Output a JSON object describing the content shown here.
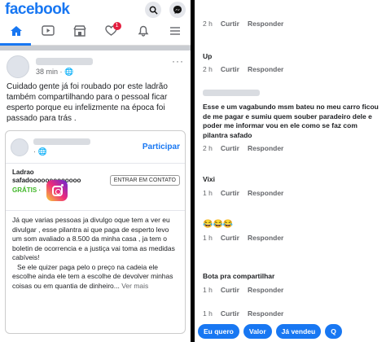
{
  "left": {
    "logo": "facebook",
    "header_icons": [
      "search-icon",
      "messenger-icon"
    ],
    "nav": {
      "tabs": [
        "home-icon",
        "video-icon",
        "marketplace-icon",
        "heart-icon",
        "bell-icon",
        "menu-icon"
      ],
      "active": "home-icon",
      "heart_badge": "1"
    },
    "post": {
      "time": "38 min · 🌐",
      "more": "···",
      "text": "Cuidado gente já foi roubado por este ladrão também compartilhando para o pessoal ficar esperto porque eu infelizmente na época foi passado para trás .",
      "shared": {
        "time": "· 🌐",
        "participar": "Participar",
        "listing_title_1": "Ladrao",
        "listing_title_2": "safadooooooooooooo",
        "contact_button": "ENTRAR EM CONTATO",
        "price": "GRÁTIS ·",
        "body_1": "Já que varias pessoas ja divulgo oque tem a ver eu divulgar , esse pilantra ai que paga de esperto levo um som avaliado a 8.500 da minha casa , ja tem o boletin de ocorrencia e a justiça vai toma as medidas cabíveis!",
        "body_2": "Se ele quizer paga pelo o preço  na cadeia ele escolhe ainda ele tem a escolhe de devolver minhas coisas ou em quantia de dinheiro...",
        "see_more": "Ver mais"
      }
    }
  },
  "right": {
    "comments": [
      {
        "text": "",
        "time": "2 h",
        "like": "Curtir",
        "reply": "Responder"
      },
      {
        "text": "Up",
        "time": "2 h",
        "like": "Curtir",
        "reply": "Responder"
      },
      {
        "text": "Esse e um vagabundo msm bateu no meu carro ficou de me pagar e sumiu quem souber paradeiro dele e poder me informar vou en ele como se faz com pilantra safado",
        "time": "2 h",
        "like": "Curtir",
        "reply": "Responder"
      },
      {
        "text": "Vixi",
        "time": "1 h",
        "like": "Curtir",
        "reply": "Responder"
      },
      {
        "text": "😂😂😂",
        "time": "1 h",
        "like": "Curtir",
        "reply": "Responder"
      },
      {
        "text": "Bota pra compartilhar",
        "time": "1 h",
        "like": "Curtir",
        "reply": "Responder"
      },
      {
        "text": "",
        "time": "1 h",
        "like": "Curtir",
        "reply": "Responder"
      }
    ],
    "chips": [
      "Eu quero",
      "Valor",
      "Já vendeu",
      "Q"
    ]
  },
  "colors": {
    "brand": "#1877f2",
    "badge": "#e41e3f",
    "price": "#42b72a"
  }
}
